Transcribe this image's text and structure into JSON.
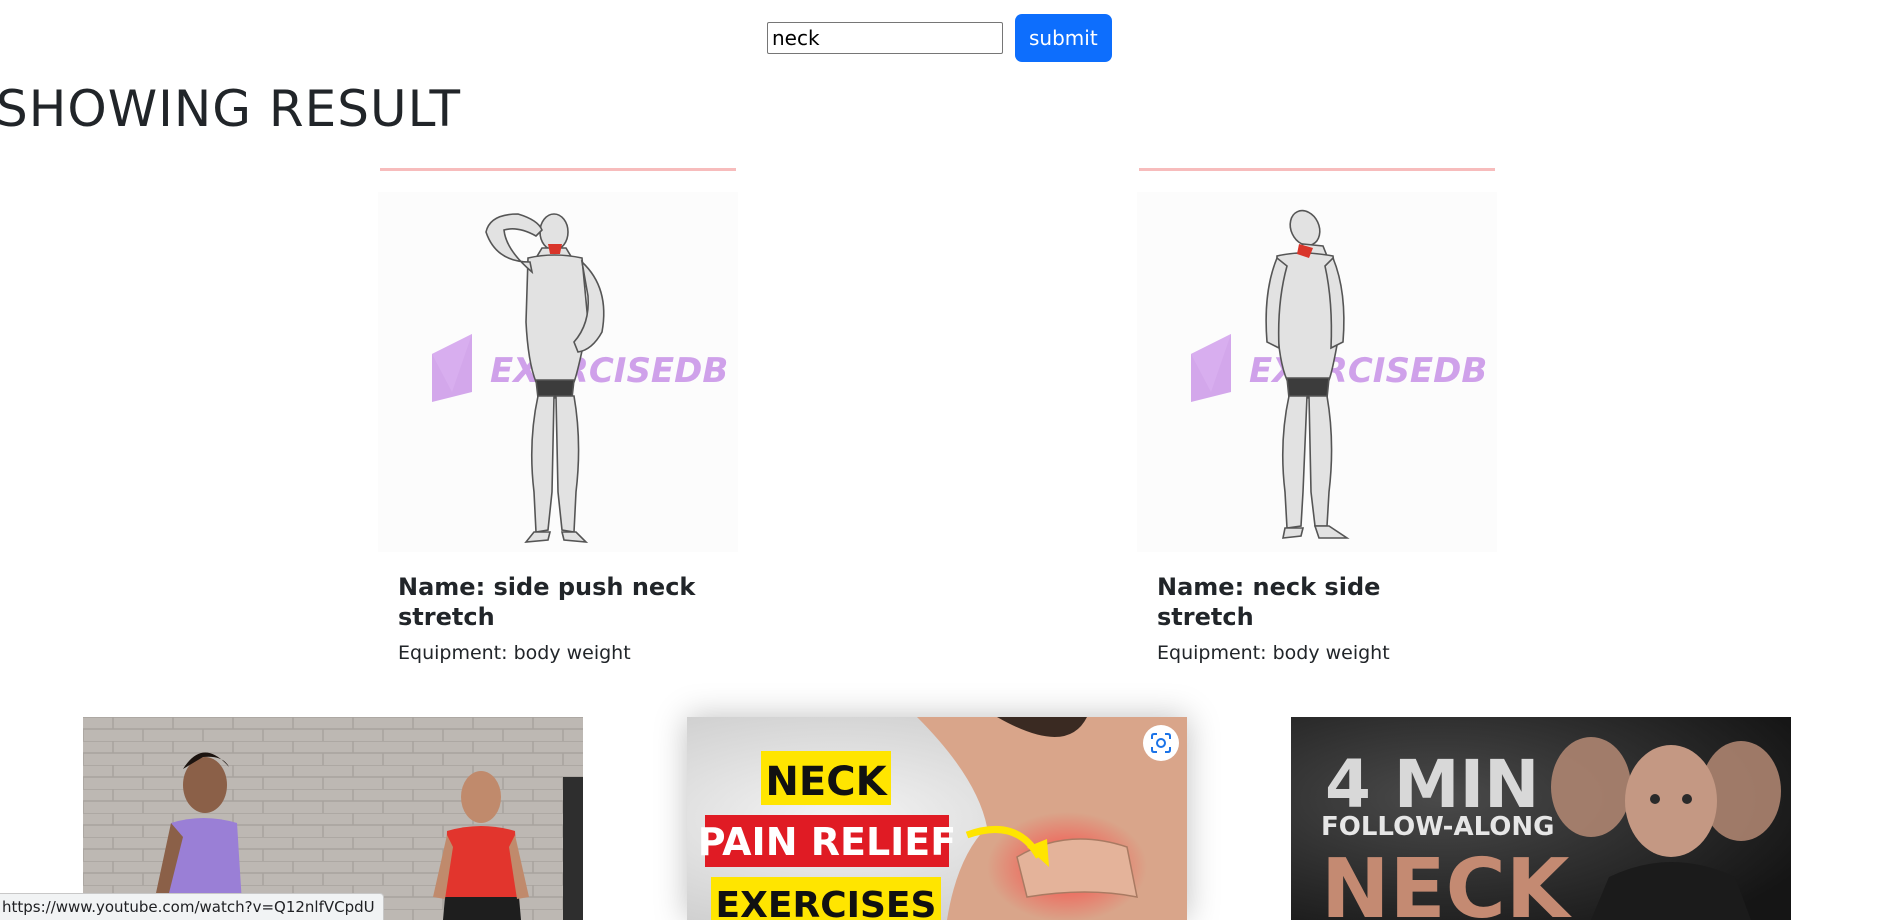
{
  "search": {
    "value": "neck",
    "submit_label": "submit"
  },
  "page_title": "SHOWING RESULT",
  "exercises": [
    {
      "name": "Name: side push neck stretch",
      "equipment": "Equipment: body weight",
      "watermark": "EXERCISEDB"
    },
    {
      "name": "Name: neck side stretch",
      "equipment": "Equipment: body weight",
      "watermark": "EXERCISEDB"
    }
  ],
  "videos": [
    {
      "title_lines": []
    },
    {
      "title_lines": [
        "NECK",
        "PAIN RELIEF",
        "EXERCISES"
      ]
    },
    {
      "title_lines": [
        "4 MIN",
        "FOLLOW-ALONG",
        "NECK"
      ]
    }
  ],
  "status_bar": {
    "url": "https://www.youtube.com/watch?v=Q12nlfVCpdU"
  },
  "colors": {
    "accent": "#0d6efd",
    "card_line": "#f7bcbc",
    "watermark": "#c58be6"
  }
}
